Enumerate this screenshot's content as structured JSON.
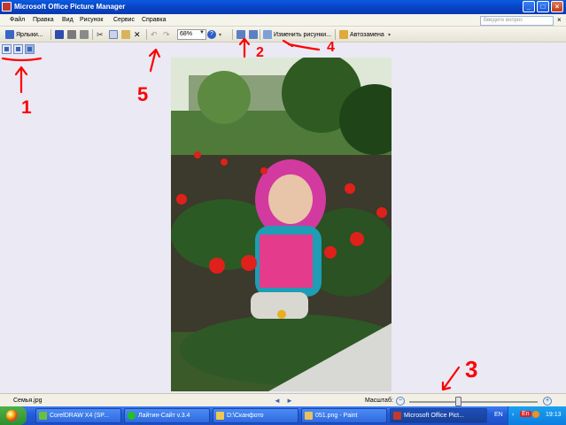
{
  "window": {
    "title": "Microsoft Office Picture Manager"
  },
  "menu": {
    "items": [
      "Файл",
      "Правка",
      "Вид",
      "Рисунок",
      "Сервис",
      "Справка"
    ],
    "help_placeholder": "Введите вопрос",
    "close_glyph": "×"
  },
  "toolbar": {
    "shortcuts_label": "Ярлыки...",
    "zoom_value": "68%",
    "edit_pictures_label": "Изменить рисунки...",
    "autocorrect_label": "Автозамена",
    "help_glyph": "?"
  },
  "status": {
    "filename": "Семья.jpg",
    "zoom_label": "Масштаб:",
    "prev_glyph": "◄",
    "next_glyph": "►",
    "zoom_out_glyph": "−",
    "zoom_in_glyph": "+",
    "zoom_level": 0.38
  },
  "taskbar": {
    "tasks": [
      "CorelDRAW X4 (SP...",
      "Лайтин-Сайт v.3.4",
      "D:\\Сканфото",
      "051.png - Paint",
      "Microsoft Office Pict..."
    ],
    "lang": "EN",
    "tray_text": "En",
    "clock": "19:13"
  },
  "annotations": [
    "1",
    "2",
    "3",
    "4",
    "5"
  ],
  "colors": {
    "titlebar": "#0a5ce0",
    "annotation": "#ff0000",
    "taskbar": "#245edb",
    "start": "#3c9c38"
  }
}
